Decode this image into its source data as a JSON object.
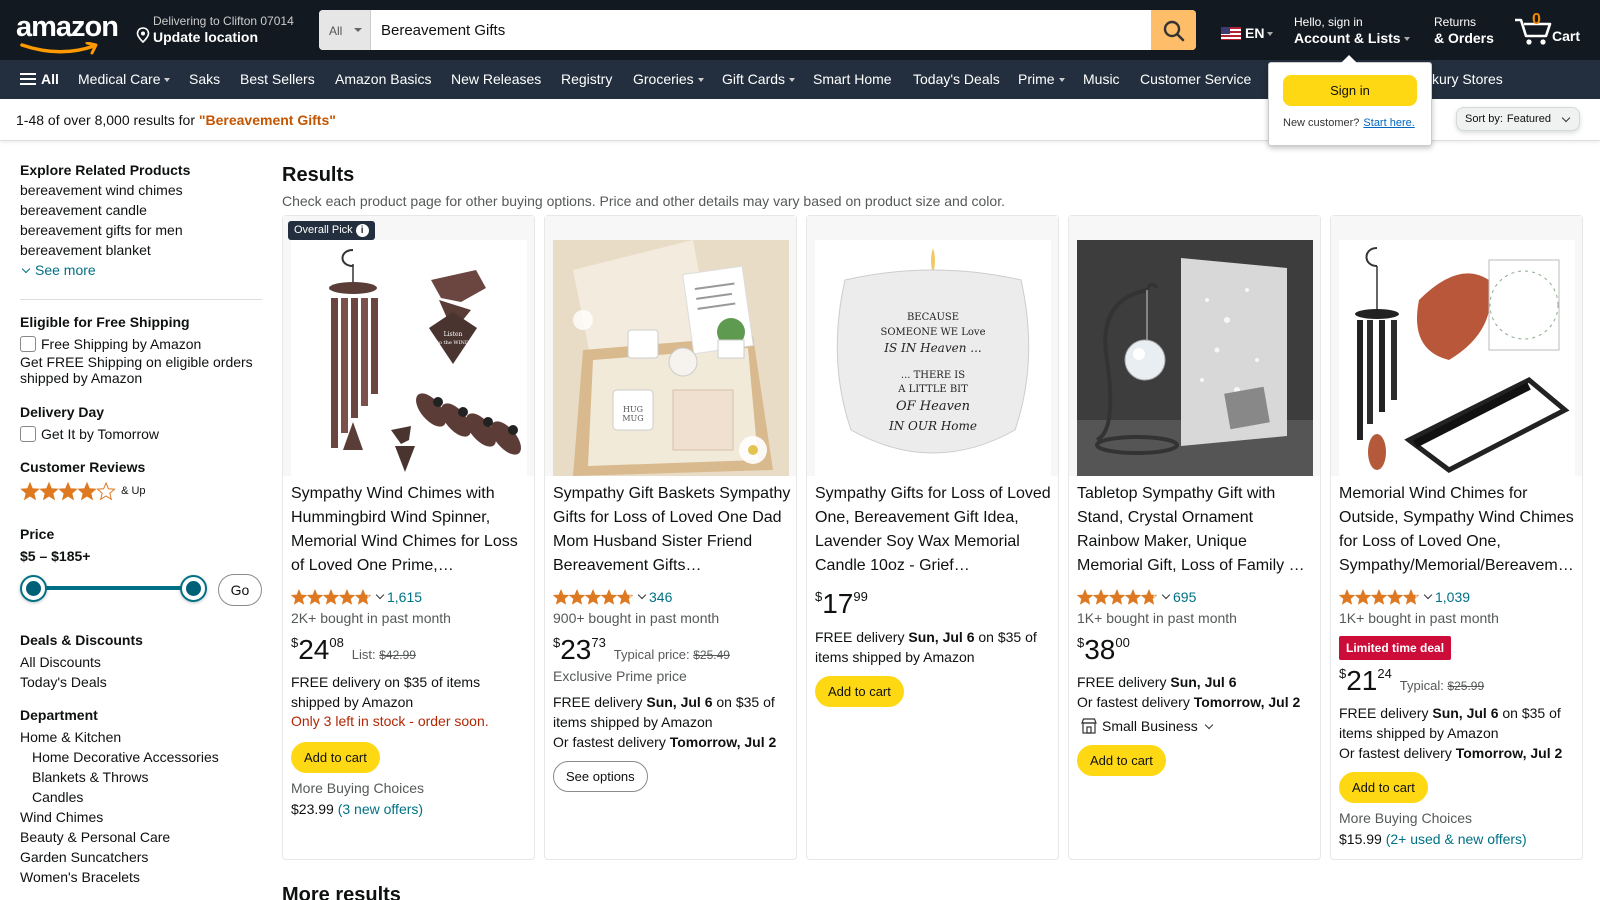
{
  "header": {
    "logo_text": "amazon",
    "deliver_line1": "Delivering to Clifton 07014",
    "deliver_line2": "Update location",
    "search_category": "All",
    "search_value": "Bereavement Gifts",
    "language": "EN",
    "account_line1": "Hello, sign in",
    "account_line2": "Account & Lists",
    "returns_line1": "Returns",
    "returns_line2": "& Orders",
    "cart_count": "0",
    "cart_label": "Cart",
    "accent_color": "#febd69"
  },
  "subnav": {
    "all": "All",
    "items": [
      "Medical Care",
      "Saks",
      "Best Sellers",
      "Amazon Basics",
      "New Releases",
      "Registry",
      "Groceries",
      "Gift Cards",
      "Smart Home",
      "Today's Deals",
      "Prime",
      "Music",
      "Customer Service",
      "kury Stores"
    ]
  },
  "flyout": {
    "signin": "Sign in",
    "new_customer": "New customer?",
    "start_here": "Start here."
  },
  "resultsbar": {
    "count_text": "1-48 of over 8,000 results for ",
    "query": "\"Bereavement Gifts\"",
    "sort_label": "Sort by:",
    "sort_value": "Featured"
  },
  "sidebar": {
    "related_title": "Explore Related Products",
    "related": [
      "bereavement wind chimes",
      "bereavement candle",
      "bereavement gifts for men",
      "bereavement blanket"
    ],
    "see_more": "See more",
    "shipping_title": "Eligible for Free Shipping",
    "shipping_option": "Free Shipping by Amazon",
    "shipping_note": "Get FREE Shipping on eligible orders shipped by Amazon",
    "delivery_title": "Delivery Day",
    "delivery_option": "Get It by Tomorrow",
    "reviews_title": "Customer Reviews",
    "reviews_up": "& Up",
    "reviews_stars": 4,
    "price_title": "Price",
    "price_range": "$5 – $185+",
    "go": "Go",
    "deals_title": "Deals & Discounts",
    "deals": [
      "All Discounts",
      "Today's Deals"
    ],
    "dept_title": "Department",
    "dept_top": "Home & Kitchen",
    "dept_sub": [
      "Home Decorative Accessories",
      "Blankets & Throws",
      "Candles"
    ],
    "dept_more": [
      "Wind Chimes",
      "Beauty & Personal Care",
      "Garden Suncatchers",
      "Women's Bracelets"
    ]
  },
  "main": {
    "title": "Results",
    "subtitle": "Check each product page for other buying options. Price and other details may vary based on product size and color.",
    "more_results": "More results"
  },
  "products": [
    {
      "badge": "Overall Pick",
      "title": "Sympathy Wind Chimes with Hummingbird Wind Spinner, Memorial Wind Chimes for Loss of Loved One Prime,…",
      "rating": 4.8,
      "reviews": "1,615",
      "bought": "2K+ bought in past month",
      "price_sym": "$",
      "price_whole": "24",
      "price_frac": "08",
      "list_label": "List:",
      "list_price": "$42.99",
      "delivery": "FREE delivery on $35 of items shipped by Amazon",
      "stock": "Only 3 left in stock - order soon.",
      "button": "Add to cart",
      "more_buying": "More Buying Choices",
      "more_price": "$23.99",
      "more_offers": "(3 new offers)"
    },
    {
      "title": "Sympathy Gift Baskets Sympathy Gifts for Loss of Loved One Dad Mom Husband Sister Friend Bereavement Gifts…",
      "rating": 4.8,
      "reviews": "346",
      "bought": "900+ bought in past month",
      "price_sym": "$",
      "price_whole": "23",
      "price_frac": "73",
      "list_label": "Typical price:",
      "list_price": "$25.49",
      "exclusive": "Exclusive Prime price",
      "delivery_pre": "FREE delivery ",
      "delivery_date": "Sun, Jul 6",
      "delivery_post": " on $35 of items shipped by Amazon",
      "fastest_pre": "Or fastest delivery ",
      "fastest_date": "Tomorrow, Jul 2",
      "button": "See options"
    },
    {
      "title": "Sympathy Gifts for Loss of Loved One, Bereavement Gift Idea, Lavender Soy Wax Memorial Candle 10oz - Grief…",
      "price_sym": "$",
      "price_whole": "17",
      "price_frac": "99",
      "delivery_pre": "FREE delivery ",
      "delivery_date": "Sun, Jul 6",
      "delivery_post": " on $35 of items shipped by Amazon",
      "button": "Add to cart",
      "candle_text": [
        "BECAUSE",
        "SOMEONE WE Love",
        "IS IN Heaven ...",
        "... THERE IS",
        "A LITTLE BIT",
        "OF Heaven",
        "IN OUR Home"
      ]
    },
    {
      "title": "Tabletop Sympathy Gift with Stand, Crystal Ornament Rainbow Maker, Unique Memorial Gift, Loss of Family …",
      "rating": 4.8,
      "reviews": "695",
      "bought": "1K+ bought in past month",
      "price_sym": "$",
      "price_whole": "38",
      "price_frac": "00",
      "delivery_pre": "FREE delivery ",
      "delivery_date": "Sun, Jul 6",
      "fastest_pre": "Or fastest delivery ",
      "fastest_date": "Tomorrow, Jul 2",
      "small_business": "Small Business",
      "button": "Add to cart"
    },
    {
      "title": "Memorial Wind Chimes for Outside, Sympathy Wind Chimes for Loss of Loved One, Sympathy/Memorial/Bereavem…",
      "rating": 4.8,
      "reviews": "1,039",
      "bought": "1K+ bought in past month",
      "deal": "Limited time deal",
      "price_sym": "$",
      "price_whole": "21",
      "price_frac": "24",
      "list_label": "Typical:",
      "list_price": "$25.99",
      "delivery_pre": "FREE delivery ",
      "delivery_date": "Sun, Jul 6",
      "delivery_post": " on $35 of items shipped by Amazon",
      "fastest_pre": "Or fastest delivery ",
      "fastest_date": "Tomorrow, Jul 2",
      "button": "Add to cart",
      "more_buying": "More Buying Choices",
      "more_price": "$15.99",
      "more_offers": "(2+ used & new offers)"
    }
  ]
}
